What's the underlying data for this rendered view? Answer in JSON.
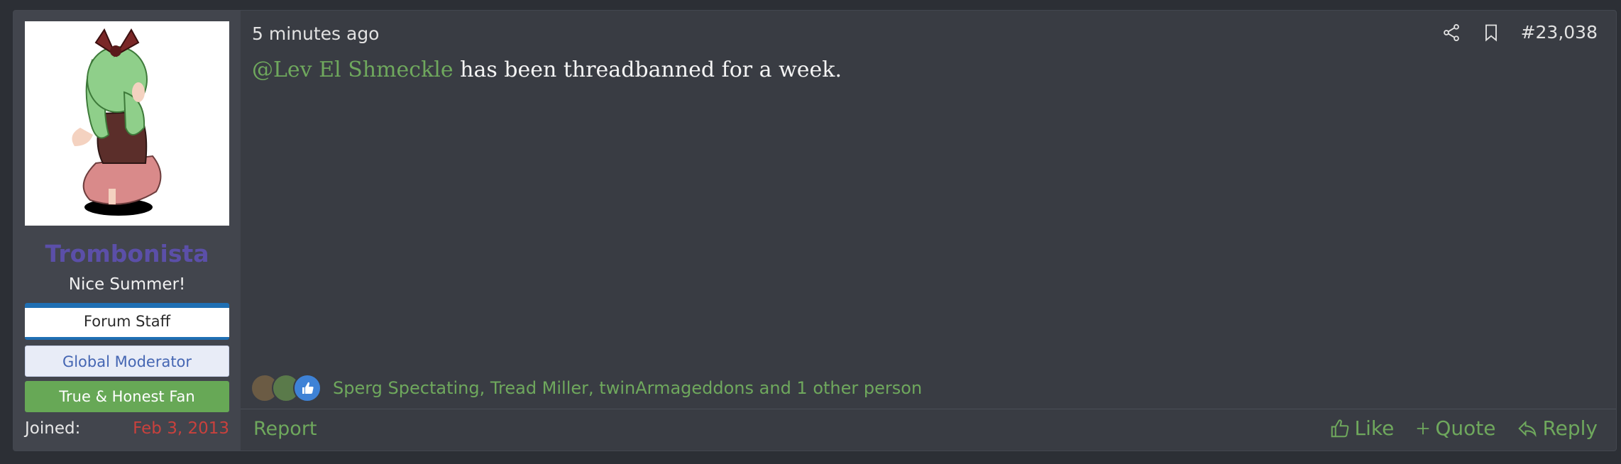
{
  "user": {
    "name": "Trombonista",
    "title": "Nice Summer!",
    "banners": [
      "Forum Staff",
      "Global Moderator",
      "True & Honest Fan"
    ],
    "joined_label": "Joined:",
    "joined_date": "Feb 3, 2013"
  },
  "post": {
    "time": "5 minutes ago",
    "number": "#23,038",
    "mention": "@Lev El Shmeckle",
    "body": " has been threadbanned for a week."
  },
  "reactions": {
    "icons": [
      "hug-reaction-icon",
      "cocktail-reaction-icon",
      "like-reaction-icon"
    ],
    "text": "Sperg Spectating, Tread Miller, twinArmageddons and 1 other person"
  },
  "footer": {
    "report": "Report",
    "like": "Like",
    "quote": "Quote",
    "reply": "Reply"
  },
  "colors": {
    "accent_green": "#6fa85d",
    "username_purple": "#5b4fa8",
    "joined_red": "#c9413d",
    "staff_blue": "#1f6fb3"
  }
}
